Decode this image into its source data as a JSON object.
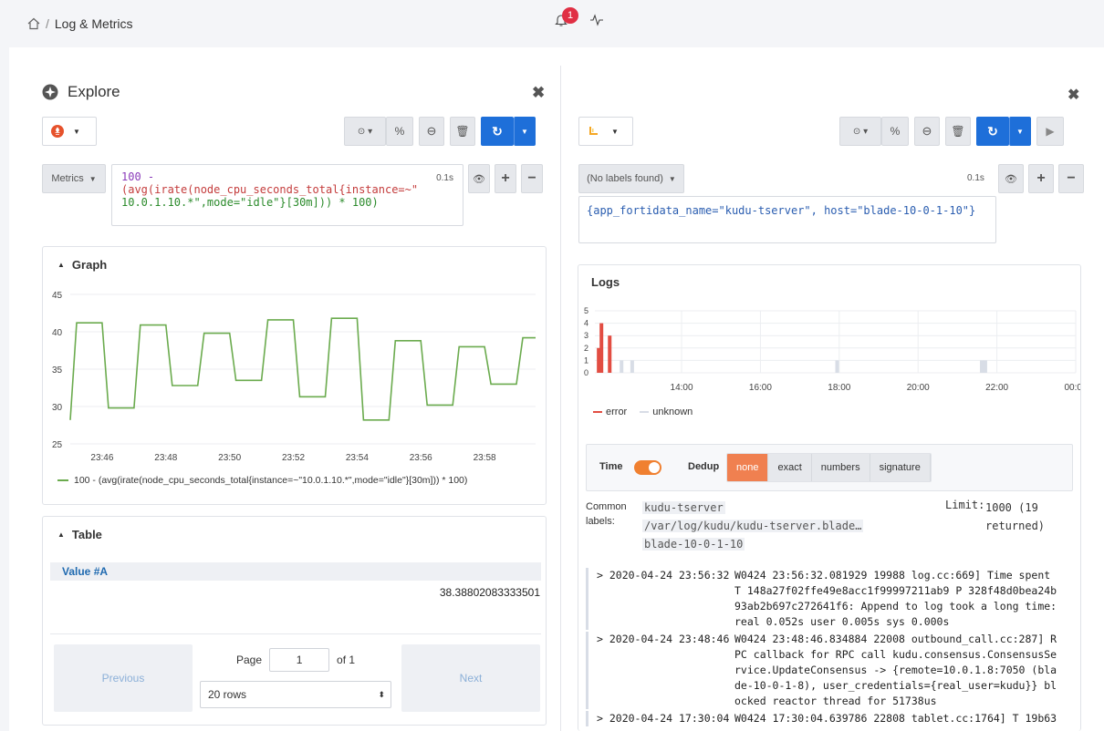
{
  "breadcrumb": {
    "home_icon": "home-icon",
    "sep": "/",
    "title": "Log & Metrics"
  },
  "topbar": {
    "notif_count": "1"
  },
  "explore": {
    "title": "Explore"
  },
  "left": {
    "metrics_label": "Metrics",
    "query": [
      "100 -",
      "(avg(irate(node_cpu_seconds_total{instance=~\"",
      "10.0.1.10.*\",mode=\"idle\"}[30m])) * 100)"
    ],
    "query_time": "0.1s",
    "graph_title": "Graph",
    "legend": "100 - (avg(irate(node_cpu_seconds_total{instance=~\"10.0.1.10.*\",mode=\"idle\"}[30m])) * 100)",
    "table_title": "Table",
    "table_header": "Value #A",
    "table_value": "38.38802083333501",
    "pager": {
      "previous": "Previous",
      "next": "Next",
      "page": "Page",
      "page_value": "1",
      "of": "of 1",
      "rows": "20 rows"
    }
  },
  "right": {
    "labels_btn": "(No labels found)",
    "query_time": "0.1s",
    "query": "{app_fortidata_name=\"kudu-tserver\", host=\"blade-10-0-1-10\"}",
    "logs_title": "Logs",
    "legend_error": "error",
    "legend_unknown": "unknown",
    "time_label": "Time",
    "dedup_label": "Dedup",
    "dedup_options": [
      "none",
      "exact",
      "numbers",
      "signature"
    ],
    "common_labels_title": "Common labels:",
    "common_labels": [
      "kudu-tserver",
      "/var/log/kudu/kudu-tserver.blade…",
      "blade-10-0-1-10"
    ],
    "limit_label": "Limit:",
    "limit_value": "1000 (19 returned)",
    "logs": [
      {
        "ts": "2020-04-24 23:56:32",
        "msg": [
          "W0424 23:56:32.081929 19988 log.cc:669] Time spent",
          "T 148a27f02ffe49e8acc1f99997211ab9 P 328f48d0bea24b",
          "93ab2b697c272641f6: Append to log took a long time:",
          "real 0.052s user 0.005s sys 0.000s"
        ]
      },
      {
        "ts": "2020-04-24 23:48:46",
        "msg": [
          "W0424 23:48:46.834884 22008 outbound_call.cc:287] R",
          "PC callback for RPC call kudu.consensus.ConsensusSe",
          "rvice.UpdateConsensus -> {remote=10.0.1.8:7050 (bla",
          "de-10-0-1-8), user_credentials={real_user=kudu}} bl",
          "ocked reactor thread for 51738us"
        ]
      },
      {
        "ts": "2020-04-24 17:30:04",
        "msg": [
          "W0424 17:30:04.639786 22808 tablet.cc:1764] T 19b63"
        ]
      }
    ]
  },
  "chart_data": [
    {
      "type": "line",
      "title": "Graph",
      "x": [
        "23:45",
        "23:45.5",
        "23:46",
        "23:46.5",
        "23:47",
        "23:47.5",
        "23:48",
        "23:48.5",
        "23:49",
        "23:49.5",
        "23:50",
        "23:50.5",
        "23:51",
        "23:51.5",
        "23:52",
        "23:52.5",
        "23:53",
        "23:53.5",
        "23:54",
        "23:54.5",
        "23:55",
        "23:55.5",
        "23:56",
        "23:56.5",
        "23:57",
        "23:57.5",
        "23:58",
        "23:58.5",
        "23:59",
        "23:59.5"
      ],
      "x_ticks": [
        "23:46",
        "23:48",
        "23:50",
        "23:52",
        "23:54",
        "23:56",
        "23:58"
      ],
      "y_ticks": [
        25,
        30,
        35,
        40,
        45
      ],
      "ylim": [
        25,
        45
      ],
      "series": [
        {
          "name": "100 - (avg(irate(node_cpu_seconds_total{instance=~\"10.0.1.10.*\",mode=\"idle\"}[30m])) * 100)",
          "color": "#6bab4e",
          "points": [
            [
              0,
              28.2
            ],
            [
              0.2,
              41.2
            ],
            [
              1,
              41.2
            ],
            [
              1.2,
              29.8
            ],
            [
              2,
              29.8
            ],
            [
              2.2,
              40.9
            ],
            [
              3,
              40.9
            ],
            [
              3.2,
              32.8
            ],
            [
              4,
              32.8
            ],
            [
              4.2,
              39.8
            ],
            [
              5,
              39.8
            ],
            [
              5.2,
              33.5
            ],
            [
              6,
              33.5
            ],
            [
              6.2,
              41.6
            ],
            [
              7,
              41.6
            ],
            [
              7.2,
              31.3
            ],
            [
              8,
              31.3
            ],
            [
              8.2,
              41.8
            ],
            [
              9,
              41.8
            ],
            [
              9.2,
              28.2
            ],
            [
              10,
              28.2
            ],
            [
              10.2,
              38.8
            ],
            [
              11,
              38.8
            ],
            [
              11.2,
              30.2
            ],
            [
              12,
              30.2
            ],
            [
              12.2,
              38.0
            ],
            [
              13,
              38.0
            ],
            [
              13.2,
              33.0
            ],
            [
              14,
              33.0
            ],
            [
              14.2,
              39.2
            ],
            [
              14.6,
              39.2
            ]
          ]
        }
      ]
    },
    {
      "type": "bar",
      "title": "Logs",
      "x_ticks": [
        "14:00",
        "16:00",
        "18:00",
        "20:00",
        "22:00",
        "00:00"
      ],
      "y_ticks": [
        0,
        1,
        2,
        3,
        4,
        5
      ],
      "ylim": [
        0,
        5
      ],
      "series": [
        {
          "name": "error",
          "color": "#e24d42",
          "bars": [
            [
              0.05,
              2
            ],
            [
              0.12,
              4
            ],
            [
              0.33,
              3
            ]
          ]
        },
        {
          "name": "unknown",
          "color": "#d8dde6",
          "bars": [
            [
              0.63,
              1
            ],
            [
              0.9,
              1
            ],
            [
              6.1,
              1
            ],
            [
              9.77,
              1
            ],
            [
              9.86,
              1
            ]
          ]
        }
      ]
    }
  ]
}
